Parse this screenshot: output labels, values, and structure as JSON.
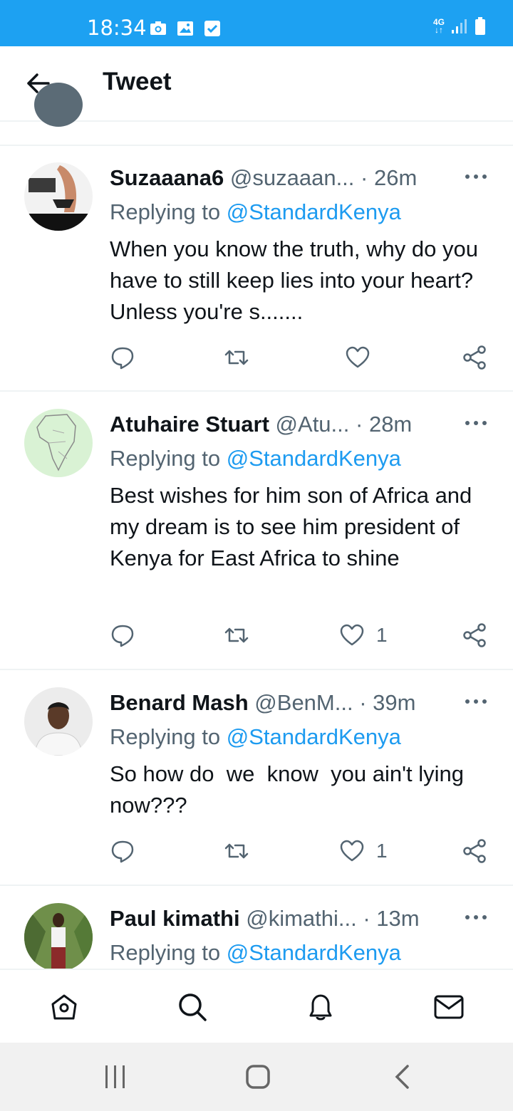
{
  "status_bar": {
    "time": "18:34",
    "network": "4G",
    "icons": [
      "camera-icon",
      "gallery-icon",
      "check-icon",
      "signal-icon",
      "battery-icon"
    ]
  },
  "header": {
    "title": "Tweet",
    "back_icon": "arrow-left-icon"
  },
  "tweets": [
    {
      "name": "Suzaaana6",
      "handle": "@suzaaan...",
      "time": "· 26m",
      "replying_prefix": "Replying to ",
      "replying_to": "@StandardKenya",
      "text": "When you know the truth, why do you have to still keep lies into your heart? Unless you're s.......",
      "like_count": ""
    },
    {
      "name": "Atuhaire Stuart",
      "handle": "@Atu...",
      "time": "· 28m",
      "replying_prefix": "Replying to ",
      "replying_to": "@StandardKenya",
      "text": "Best wishes for him son of Africa and my dream is to see him president of Kenya for East Africa to shine",
      "like_count": "1"
    },
    {
      "name": "Benard Mash",
      "handle": "@BenM...",
      "time": "· 39m",
      "replying_prefix": "Replying to ",
      "replying_to": "@StandardKenya",
      "text": "So how do  we  know  you ain't lying now???",
      "like_count": "1"
    },
    {
      "name": "Paul kimathi",
      "handle": "@kimathi...",
      "time": "· 13m",
      "replying_prefix": "Replying to ",
      "replying_to": "@StandardKenya",
      "text": "",
      "like_count": ""
    }
  ],
  "bottom_nav": [
    "home-icon",
    "search-icon",
    "notifications-icon",
    "messages-icon"
  ],
  "system_nav": [
    "recent-apps-icon",
    "home-button-icon",
    "back-icon"
  ],
  "colors": {
    "accent": "#1d9bf0",
    "status_bar": "#1da1f2",
    "secondary_text": "#536471"
  }
}
